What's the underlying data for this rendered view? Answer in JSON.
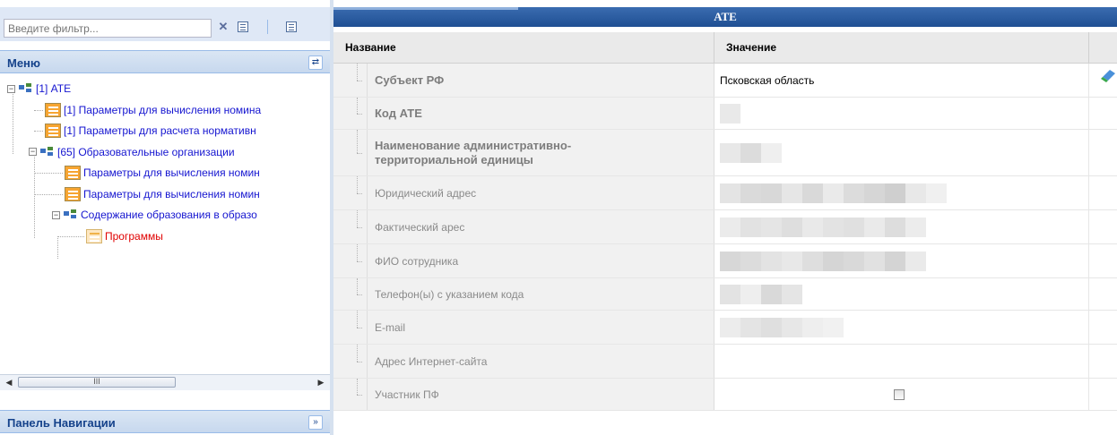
{
  "filter": {
    "placeholder": "Введите фильтр..."
  },
  "menu_panel": {
    "title": "Меню"
  },
  "nav_panel": {
    "title": "Панель Навигации"
  },
  "tree": [
    {
      "label": "[1] АТЕ",
      "type": "group",
      "expanded": true,
      "level": 0
    },
    {
      "label": "[1] Параметры для вычисления номина",
      "type": "table",
      "level": 1
    },
    {
      "label": "[1] Параметры для расчета нормативн",
      "type": "table",
      "level": 1
    },
    {
      "label": "[65] Образовательные организации",
      "type": "group",
      "expanded": true,
      "level": 1
    },
    {
      "label": "Параметры для вычисления номин",
      "type": "table",
      "level": 2
    },
    {
      "label": "Параметры для вычисления номин",
      "type": "table",
      "level": 2
    },
    {
      "label": "Содержание образования в образо",
      "type": "group",
      "expanded": true,
      "level": 2
    },
    {
      "label": "Программы",
      "type": "table",
      "level": 3,
      "selected": true
    }
  ],
  "grid": {
    "title": "АТЕ",
    "columns": {
      "name": "Название",
      "value": "Значение"
    },
    "rows": [
      {
        "name": "Субъект РФ",
        "bold": true,
        "value": "Псковская область"
      },
      {
        "name": "Код АТЕ",
        "bold": true,
        "value": "",
        "redacted": true
      },
      {
        "name": "Наименование административно-территориальной единицы",
        "bold": true,
        "value": "",
        "redacted": true
      },
      {
        "name": "Юридический адрес",
        "bold": false,
        "value": "",
        "redacted": true
      },
      {
        "name": "Фактический арес",
        "bold": false,
        "value": "",
        "redacted": true
      },
      {
        "name": "ФИО сотрудника",
        "bold": false,
        "value": "",
        "redacted": true
      },
      {
        "name": "Телефон(ы) с указанием кода",
        "bold": false,
        "value": "",
        "redacted": true
      },
      {
        "name": "E-mail",
        "bold": false,
        "value": "",
        "redacted": true
      },
      {
        "name": "Адрес Интернет-сайта",
        "bold": false,
        "value": ""
      },
      {
        "name": "Участник ПФ",
        "bold": false,
        "value": "",
        "checkbox": true,
        "checked": false
      }
    ]
  },
  "colors": {
    "header_blue": "#1f4f93",
    "panel_title": "#15428b",
    "tree_link": "#1515d0",
    "selected_red": "#e00000"
  },
  "icons": [
    "clear-filter-icon",
    "expand-all-icon",
    "collapse-all-icon",
    "refresh-icon",
    "chevron-down-double-icon",
    "edit-record-icon"
  ]
}
